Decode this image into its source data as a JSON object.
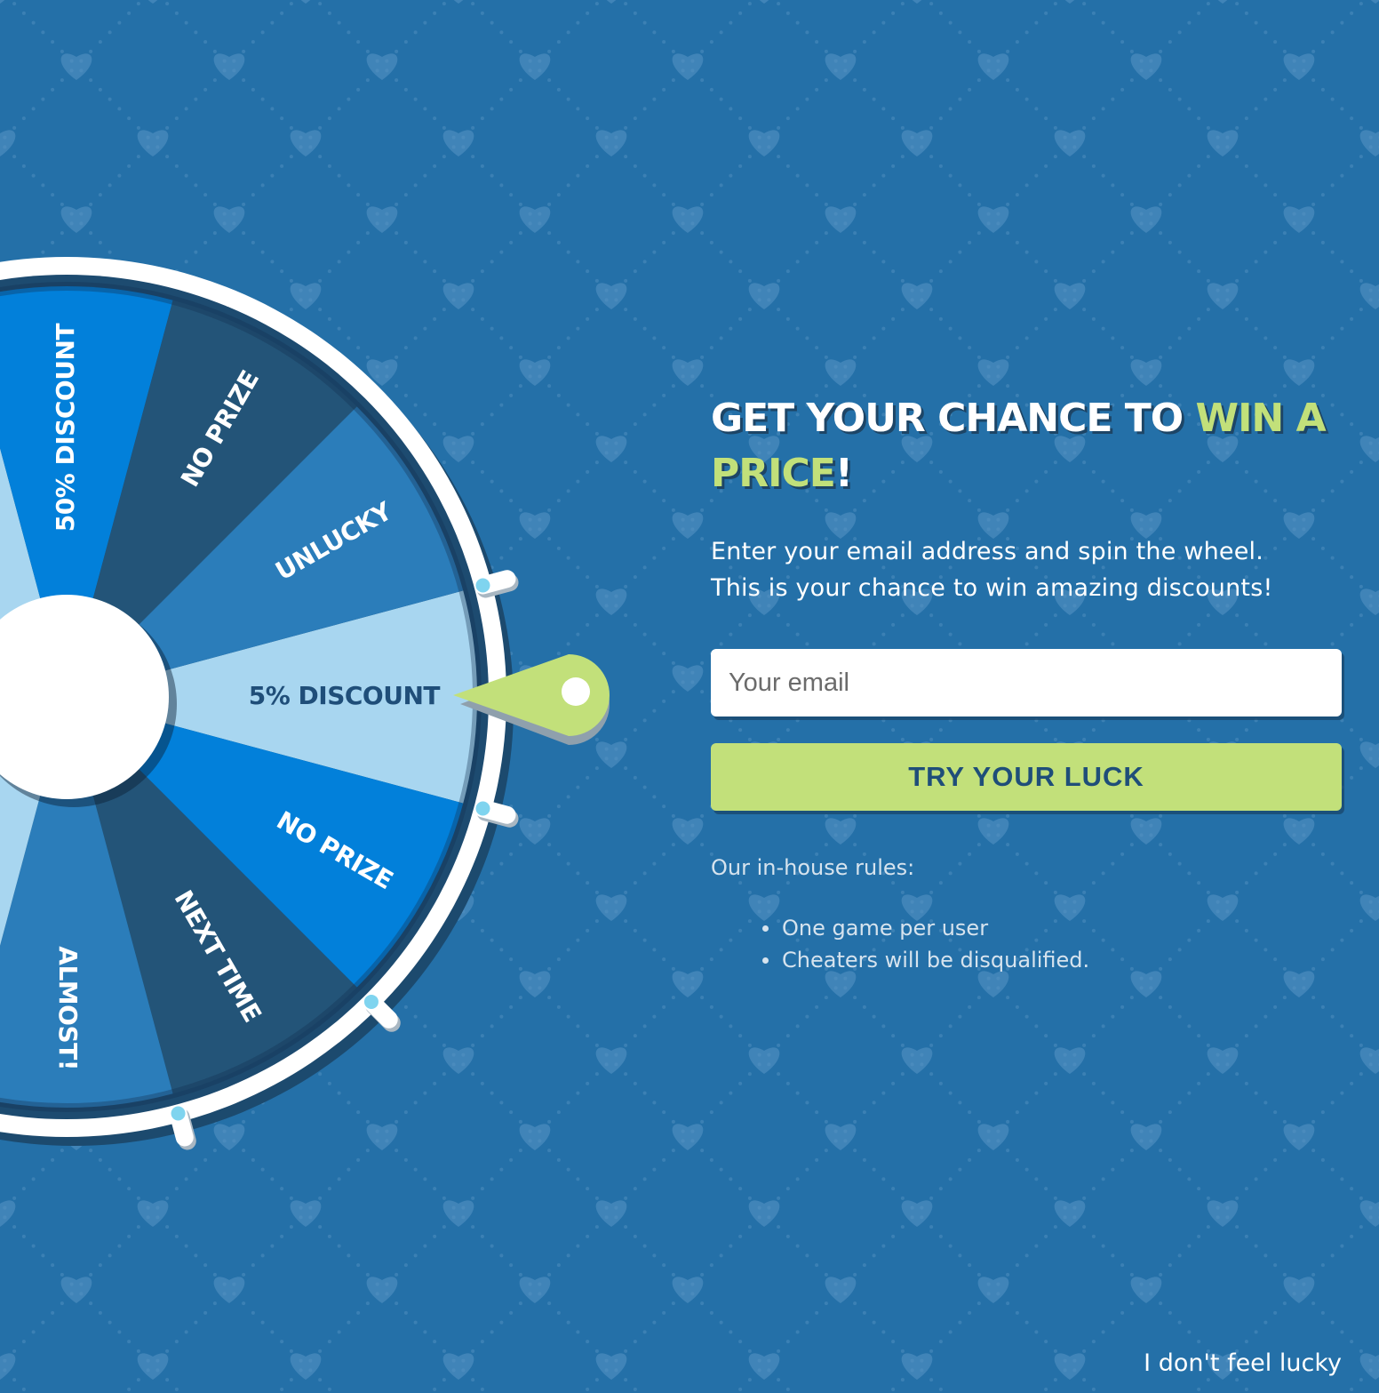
{
  "colors": {
    "background": "#2470a8",
    "accent": "#c2e07a",
    "button_text": "#1f4e79",
    "heart": "#5794c4"
  },
  "wheel": {
    "segments": [
      {
        "label": "5% DISCOUNT",
        "fill": "#a8d6f0",
        "text_color": "#1f4e79"
      },
      {
        "label": "NO PRIZE",
        "fill": "#0280da",
        "text_color": "#ffffff"
      },
      {
        "label": "NEXT TIME",
        "fill": "#235478",
        "text_color": "#ffffff"
      },
      {
        "label": "ALMOST!",
        "fill": "#2b7dba",
        "text_color": "#ffffff"
      },
      {
        "label": "",
        "fill": "#a8d6f0",
        "text_color": "#1f4e79"
      },
      {
        "label": "",
        "fill": "#0280da",
        "text_color": "#ffffff"
      },
      {
        "label": "",
        "fill": "#235478",
        "text_color": "#ffffff"
      },
      {
        "label": "",
        "fill": "#2b7dba",
        "text_color": "#ffffff"
      },
      {
        "label": "",
        "fill": "#a8d6f0",
        "text_color": "#1f4e79"
      },
      {
        "label": "50% DISCOUNT",
        "fill": "#0280da",
        "text_color": "#ffffff"
      },
      {
        "label": "NO PRIZE",
        "fill": "#235478",
        "text_color": "#ffffff"
      },
      {
        "label": "UNLUCKY",
        "fill": "#2b7dba",
        "text_color": "#ffffff"
      }
    ],
    "pointer_icon": "pointer-icon"
  },
  "headline": {
    "part1": "GET YOUR CHANCE TO ",
    "accent": "WIN A PRICE",
    "part2": "!"
  },
  "subtext": {
    "line1": "Enter your email address and spin the wheel.",
    "line2": "This is your chance to win amazing discounts!"
  },
  "form": {
    "email_placeholder": "Your email",
    "email_value": "",
    "submit_label": "TRY YOUR LUCK"
  },
  "rules": {
    "title": "Our in-house rules:",
    "items": [
      "One game per user",
      "Cheaters will be disqualified."
    ]
  },
  "footer": {
    "no_luck_label": "I don't feel lucky"
  }
}
